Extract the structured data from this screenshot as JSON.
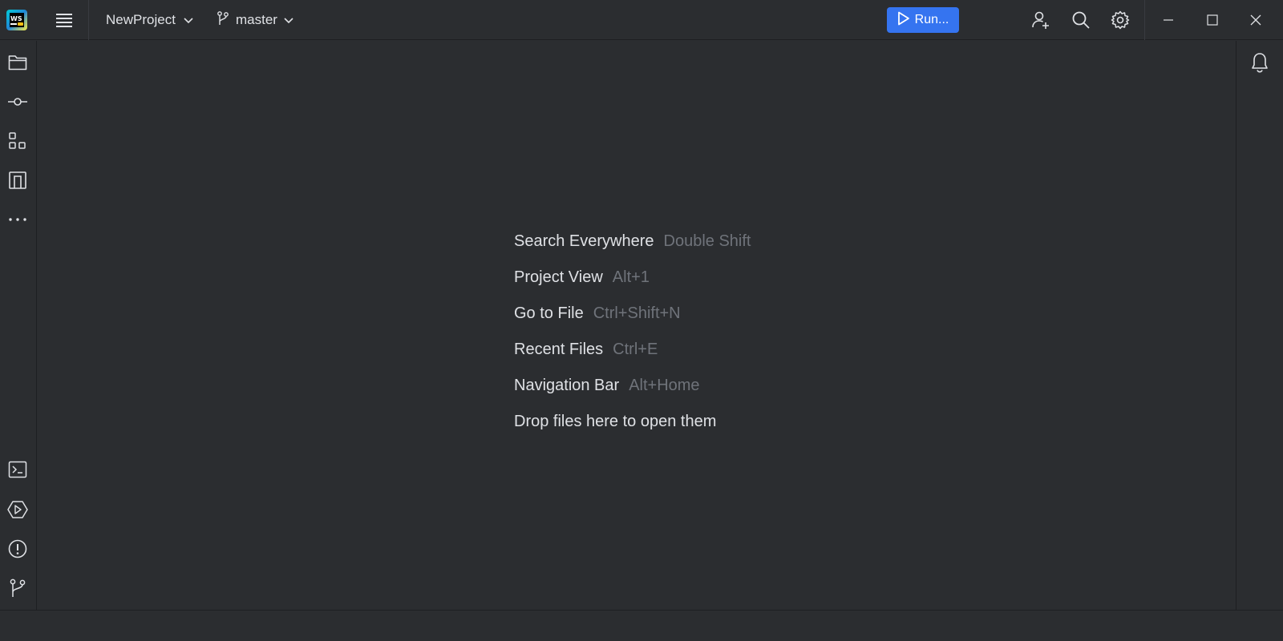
{
  "app": {
    "logo_text": "WS",
    "project_name": "NewProject",
    "branch": "master",
    "run_label": "Run..."
  },
  "colors": {
    "accent": "#3574f0",
    "background": "#2b2d30",
    "text": "#dfe1e5",
    "muted": "#6f737a"
  },
  "left_strip": {
    "top_icons": [
      "folder-icon",
      "commit-icon",
      "structure-icon",
      "bookmarks-icon",
      "more-icon"
    ],
    "bottom_icons": [
      "terminal-icon",
      "services-icon",
      "problems-icon",
      "git-icon"
    ]
  },
  "right_strip": {
    "icons": [
      "notifications-icon"
    ]
  },
  "hints": [
    {
      "label": "Search Everywhere",
      "shortcut": "Double Shift"
    },
    {
      "label": "Project View",
      "shortcut": "Alt+1"
    },
    {
      "label": "Go to File",
      "shortcut": "Ctrl+Shift+N"
    },
    {
      "label": "Recent Files",
      "shortcut": "Ctrl+E"
    },
    {
      "label": "Navigation Bar",
      "shortcut": "Alt+Home"
    },
    {
      "label": "Drop files here to open them",
      "shortcut": ""
    }
  ]
}
